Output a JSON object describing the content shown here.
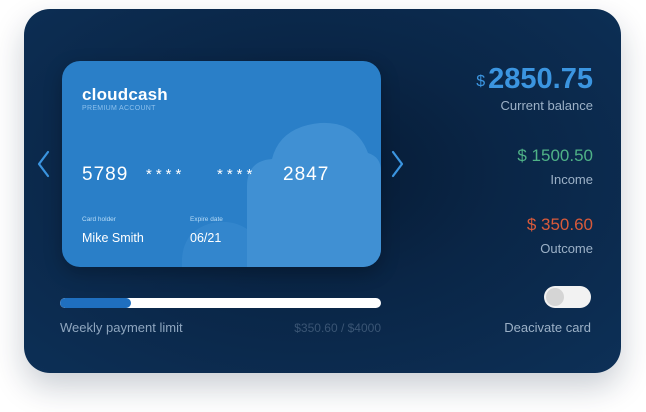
{
  "card": {
    "brand": "cloudcash",
    "account_type": "PREMIUM ACCOUNT",
    "number_groups": [
      "5789",
      "****",
      "****",
      "2847"
    ],
    "holder_label": "Card holder",
    "holder_name": "Mike Smith",
    "expire_label": "Expire date",
    "expire_date": "06/21"
  },
  "balance": {
    "currency": "$",
    "amount": "2850.75",
    "label": "Current balance"
  },
  "income": {
    "amount": "$ 1500.50",
    "label": "Income"
  },
  "outcome": {
    "amount": "$ 350.60",
    "label": "Outcome"
  },
  "limit": {
    "label": "Weekly payment limit",
    "value": "$350.60 / $4000",
    "progress": 0.22
  },
  "toggle": {
    "label": "Deacivate card",
    "enabled": false
  },
  "icons": {
    "prev": "chevron-left-icon",
    "next": "chevron-right-icon"
  },
  "colors": {
    "panel_bg": "#0a2647",
    "card_bg": "#2a7fc8",
    "balance": "#3b95e0",
    "income": "#4fb287",
    "outcome": "#d95a3a",
    "progress_fill": "#1f6fbf"
  }
}
